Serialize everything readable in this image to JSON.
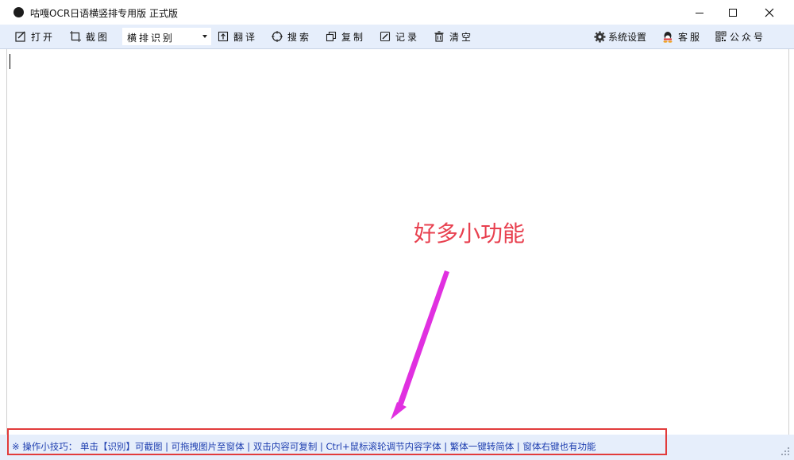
{
  "window": {
    "title": "咕嘎OCR日语横竖排专用版 正式版",
    "controls": [
      "minimize",
      "maximize",
      "close"
    ]
  },
  "toolbar": {
    "open_label": "打开",
    "screenshot_label": "截图",
    "mode_value": "横排识别",
    "translate_label": "翻译",
    "search_label": "搜索",
    "copy_label": "复制",
    "history_label": "记录",
    "clear_label": "清空",
    "settings_label": "系统设置",
    "support_label": "客服",
    "wechat_label": "公众号"
  },
  "editor": {
    "content": ""
  },
  "annotation": {
    "text": "好多小功能",
    "color": "#e8404f",
    "arrow_color": "#e030e0",
    "highlight_color": "#e23b3b"
  },
  "statusbar": {
    "tips": "※ 操作小技巧： 单击【识别】可截图 | 可拖拽图片至窗体 |  双击内容可复制 | Ctrl+鼠标滚轮调节内容字体 | 繁体一键转简体 | 窗体右键也有功能"
  },
  "colors": {
    "toolbar_bg": "#e6eefb",
    "tip_text": "#1f3fb0"
  }
}
